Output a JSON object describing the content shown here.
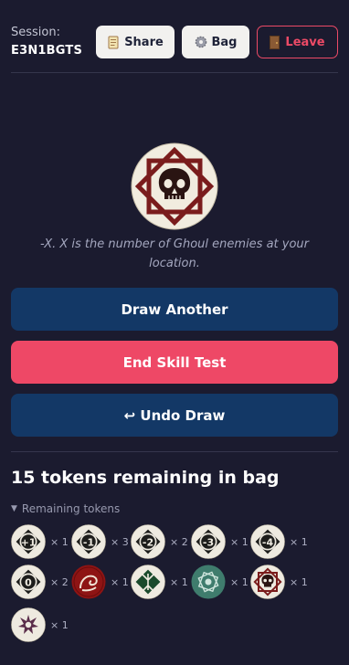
{
  "session": {
    "label": "Session:",
    "code": "E3N1BGTS"
  },
  "header": {
    "share_label": "Share",
    "bag_label": "Bag",
    "leave_label": "Leave"
  },
  "drawn_token": {
    "icon": "skull-icon",
    "description": "-X. X is the number of Ghoul enemies at your location."
  },
  "actions": {
    "draw_another": "Draw Another",
    "end_skill_test": "End Skill Test",
    "undo_draw": "↩ Undo Draw"
  },
  "bag": {
    "remaining_title": "15 tokens remaining in bag",
    "summary_label": "Remaining tokens",
    "tokens": [
      {
        "label": "+1",
        "count": "× 1",
        "icon": "plus-one-token-icon"
      },
      {
        "label": "-1",
        "count": "× 3",
        "icon": "minus-one-token-icon"
      },
      {
        "label": "-2",
        "count": "× 2",
        "icon": "minus-two-token-icon"
      },
      {
        "label": "-3",
        "count": "× 1",
        "icon": "minus-three-token-icon"
      },
      {
        "label": "-4",
        "count": "× 1",
        "icon": "minus-four-token-icon"
      },
      {
        "label": "0",
        "count": "× 2",
        "icon": "zero-token-icon"
      },
      {
        "label": "",
        "count": "× 1",
        "icon": "tentacle-token-icon"
      },
      {
        "label": "",
        "count": "× 1",
        "icon": "elder-sign-token-icon"
      },
      {
        "label": "",
        "count": "× 1",
        "icon": "cultist-token-icon"
      },
      {
        "label": "",
        "count": "× 1",
        "icon": "skull-token-icon"
      },
      {
        "label": "",
        "count": "× 1",
        "icon": "elder-thing-token-icon"
      }
    ]
  },
  "colors": {
    "background": "#1b1b2f",
    "primary_button": "#133866",
    "danger_button": "#ee4866",
    "leave_border": "#ec4a66",
    "token_face": "#eeeae0"
  }
}
